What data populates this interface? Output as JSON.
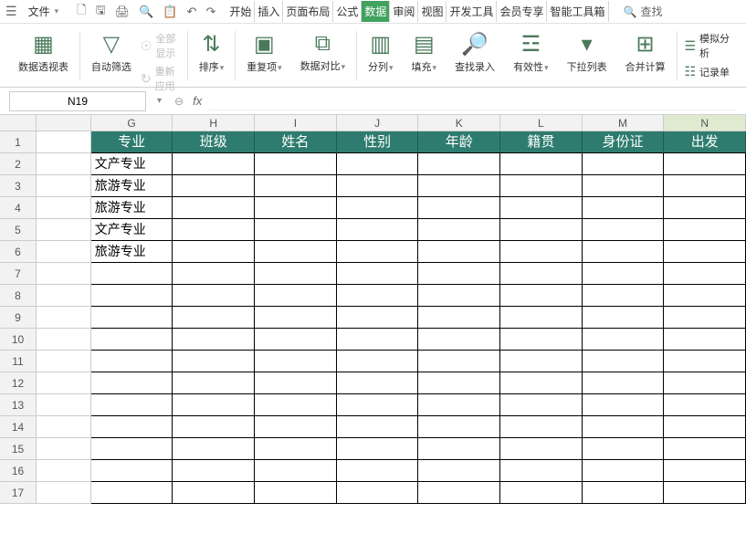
{
  "file_menu": "文件",
  "tabs": {
    "start": "开始",
    "insert": "插入",
    "layout": "页面布局",
    "formula": "公式",
    "data": "数据",
    "review": "审阅",
    "view": "视图",
    "devtools": "开发工具",
    "member": "会员专享",
    "smartbox": "智能工具箱"
  },
  "search_label": "查找",
  "ribbon": {
    "pivot": "数据透视表",
    "autofilter": "自动筛选",
    "showall": "全部显示",
    "reapply": "重新应用",
    "sort": "排序",
    "dedup": "重复项",
    "compare": "数据对比",
    "split": "分列",
    "fill": "填充",
    "lookup": "查找录入",
    "validation": "有效性",
    "dropdown": "下拉列表",
    "consolidate": "合并计算",
    "simulate": "模拟分析",
    "form": "记录单"
  },
  "name_box": "N19",
  "col_headers": [
    "G",
    "H",
    "I",
    "J",
    "K",
    "L",
    "M",
    "N"
  ],
  "row_headers": [
    1,
    2,
    3,
    4,
    5,
    6,
    7,
    8,
    9,
    10,
    11,
    12,
    13,
    14,
    15,
    16,
    17
  ],
  "table_headers": [
    "专业",
    "班级",
    "姓名",
    "性别",
    "年龄",
    "籍贯",
    "身份证",
    "出发"
  ],
  "table_data_colG": [
    "文产专业",
    "旅游专业",
    "旅游专业",
    "文产专业",
    "旅游专业"
  ]
}
